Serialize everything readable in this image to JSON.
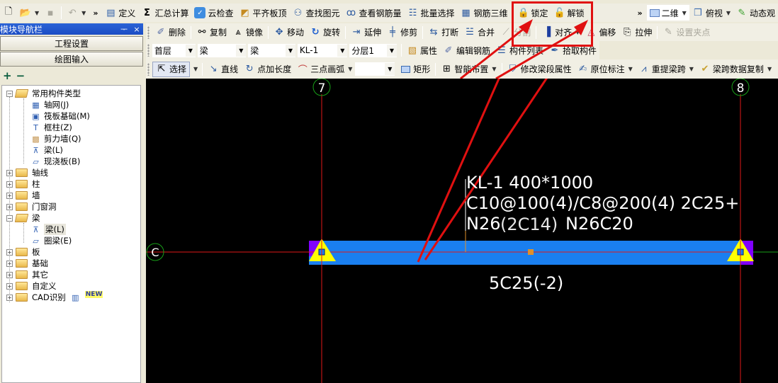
{
  "toolbar_main": {
    "items": [
      {
        "label": "定义",
        "icon": "define-icon"
      },
      {
        "label": "汇总计算",
        "icon": "sigma-icon"
      },
      {
        "label": "云检查",
        "icon": "cloud-check-icon"
      },
      {
        "label": "平齐板顶",
        "icon": "align-slab-top-icon"
      },
      {
        "label": "查找图元",
        "icon": "binoculars-icon"
      },
      {
        "label": "查看钢筋量",
        "icon": "glasses-icon"
      },
      {
        "label": "批量选择",
        "icon": "batch-select-icon"
      },
      {
        "label": "钢筋三维",
        "icon": "rebar-3d-icon"
      },
      {
        "label": "锁定",
        "icon": "lock-icon"
      },
      {
        "label": "解锁",
        "icon": "unlock-icon"
      }
    ],
    "view_mode": "二维",
    "view_angle": "俯视",
    "dynamic_label": "动态观"
  },
  "toolbar_edit": {
    "items": [
      {
        "label": "删除",
        "icon": "eraser-icon",
        "disabled": false
      },
      {
        "label": "复制",
        "icon": "copy-icon",
        "disabled": false
      },
      {
        "label": "镜像",
        "icon": "mirror-icon",
        "disabled": false
      },
      {
        "label": "移动",
        "icon": "move-icon",
        "disabled": false
      },
      {
        "label": "旋转",
        "icon": "rotate-icon",
        "disabled": false
      },
      {
        "label": "延伸",
        "icon": "extend-icon",
        "disabled": false
      },
      {
        "label": "修剪",
        "icon": "trim-icon",
        "disabled": false
      },
      {
        "label": "打断",
        "icon": "break-icon",
        "disabled": false
      },
      {
        "label": "合并",
        "icon": "merge-icon",
        "disabled": false
      },
      {
        "label": "分割",
        "icon": "split-icon",
        "disabled": true
      },
      {
        "label": "对齐",
        "icon": "align-icon",
        "disabled": false
      },
      {
        "label": "偏移",
        "icon": "offset-icon",
        "disabled": false
      },
      {
        "label": "拉伸",
        "icon": "stretch-icon",
        "disabled": false
      },
      {
        "label": "设置夹点",
        "icon": "grip-point-icon",
        "disabled": true
      }
    ]
  },
  "toolbar_filter": {
    "floor": "首层",
    "category": "梁",
    "type": "梁",
    "component": "KL-1",
    "layer": "分层1",
    "properties_label": "属性",
    "edit_rebar_label": "编辑钢筋",
    "component_list_label": "构件列表",
    "pick_component_label": "拾取构件"
  },
  "toolbar_draw": {
    "select_label": "选择",
    "line_label": "直线",
    "point_length_label": "点加长度",
    "arc_label": "三点画弧",
    "blank_combo": "",
    "rect_label": "矩形",
    "smart_layout_label": "智能布置",
    "modify_span_label": "修改梁段属性",
    "in_place_label": "原位标注",
    "respan_label": "重提梁跨",
    "span_copy_label": "梁跨数据复制"
  },
  "nav": {
    "title": "模块导航栏",
    "pin": "ᅮ",
    "close": "×",
    "project_settings": "工程设置",
    "drawing_input": "绘图输入",
    "expand_all": "+",
    "collapse_all": "−",
    "tree": {
      "common": {
        "label": "常用构件类型",
        "children": [
          "轴网(J)",
          "筏板基础(M)",
          "框柱(Z)",
          "剪力墙(Q)",
          "梁(L)",
          "现浇板(B)"
        ]
      },
      "groups": [
        "轴线",
        "柱",
        "墙",
        "门窗洞"
      ],
      "beam": {
        "label": "梁",
        "children": [
          "梁(L)",
          "圈梁(E)"
        ],
        "selected": "梁(L)"
      },
      "groups2": [
        "板",
        "基础",
        "其它",
        "自定义"
      ],
      "cad": {
        "label": "CAD识别",
        "badge": "NEW"
      }
    }
  },
  "canvas": {
    "axis_labels": {
      "left_vertical": "7",
      "right_vertical": "8",
      "horizontal": "C"
    },
    "beam_annotation": {
      "line1": "KL-1 400*1000",
      "line2": "C10@100(4)/C8@200(4) 2C25+",
      "line3": "N26C20",
      "line3_prefix": "N26",
      "overlap": "(2C14)",
      "bottom": "5C25(-2)"
    },
    "colors": {
      "beam": "#1a7ff0",
      "axis": "#e01818",
      "column_triangle": "#ffff00",
      "column_fill": "#8000ff",
      "axis_circle": "#18a018",
      "highlight": "#e01010"
    }
  }
}
